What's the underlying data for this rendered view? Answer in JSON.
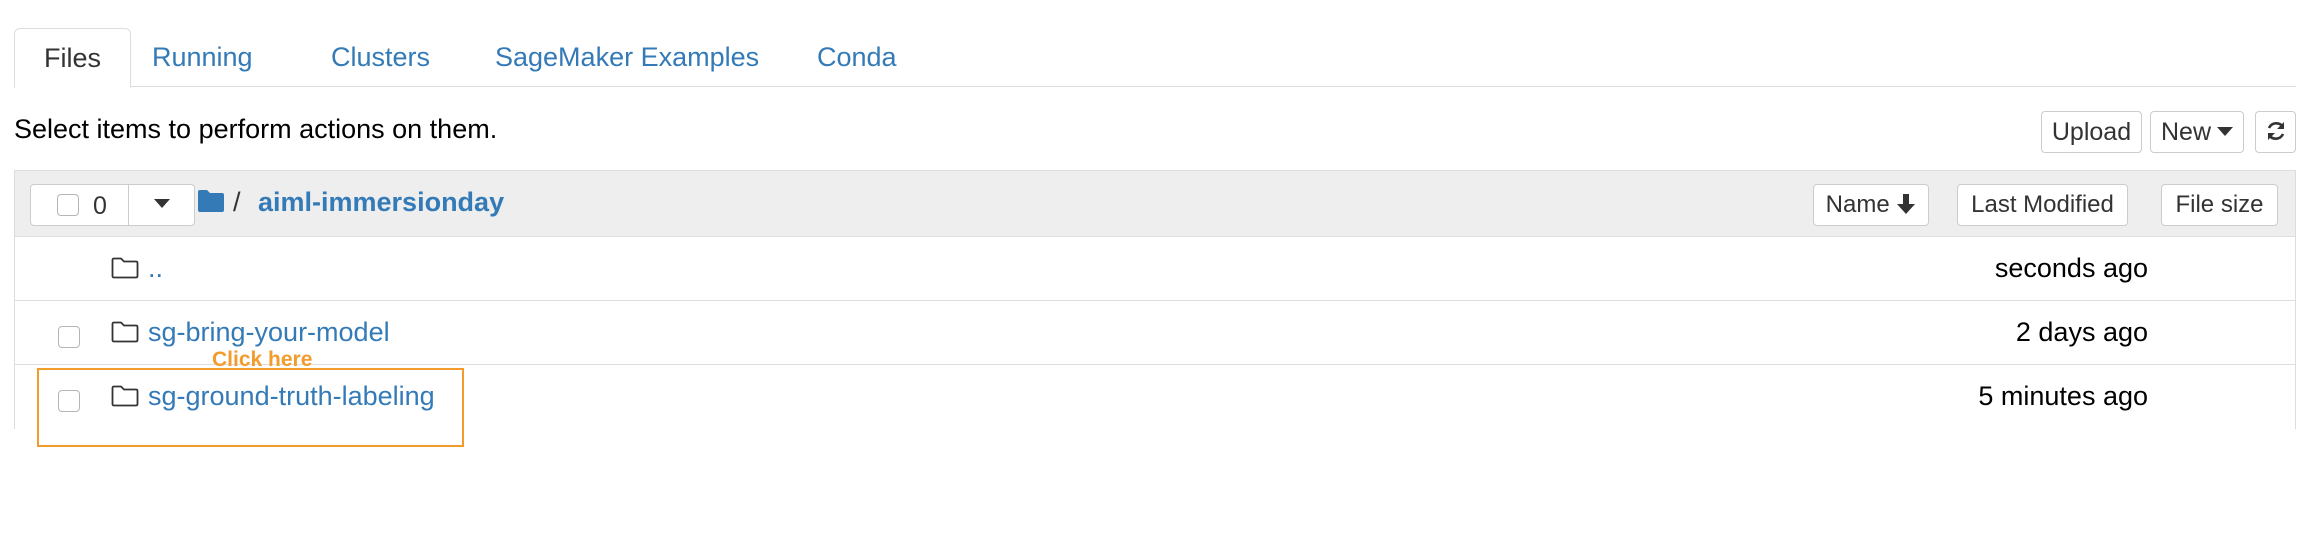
{
  "tabs": [
    {
      "label": "Files",
      "active": true
    },
    {
      "label": "Running",
      "active": false
    },
    {
      "label": "Clusters",
      "active": false
    },
    {
      "label": "SageMaker Examples",
      "active": false
    },
    {
      "label": "Conda",
      "active": false
    }
  ],
  "toolbar": {
    "hint": "Select items to perform actions on them.",
    "upload_label": "Upload",
    "new_label": "New",
    "refresh_icon": "refresh-icon"
  },
  "list_header": {
    "selected_count": "0",
    "path_separator": "/",
    "current_dir": "aiml-immersionday",
    "sort_name_label": "Name",
    "sort_modified_label": "Last Modified",
    "sort_size_label": "File size"
  },
  "items": [
    {
      "name": "..",
      "modified": "seconds ago",
      "type": "folder",
      "selectable": false
    },
    {
      "name": "sg-bring-your-model",
      "modified": "2 days ago",
      "type": "folder",
      "selectable": true
    },
    {
      "name": "sg-ground-truth-labeling",
      "modified": "5 minutes ago",
      "type": "folder",
      "selectable": true
    }
  ],
  "annotation": {
    "text": "Click here",
    "color": "#f39c2e"
  },
  "colors": {
    "link": "#337ab7",
    "header_bg": "#eeeeee",
    "border": "#dddddd"
  }
}
